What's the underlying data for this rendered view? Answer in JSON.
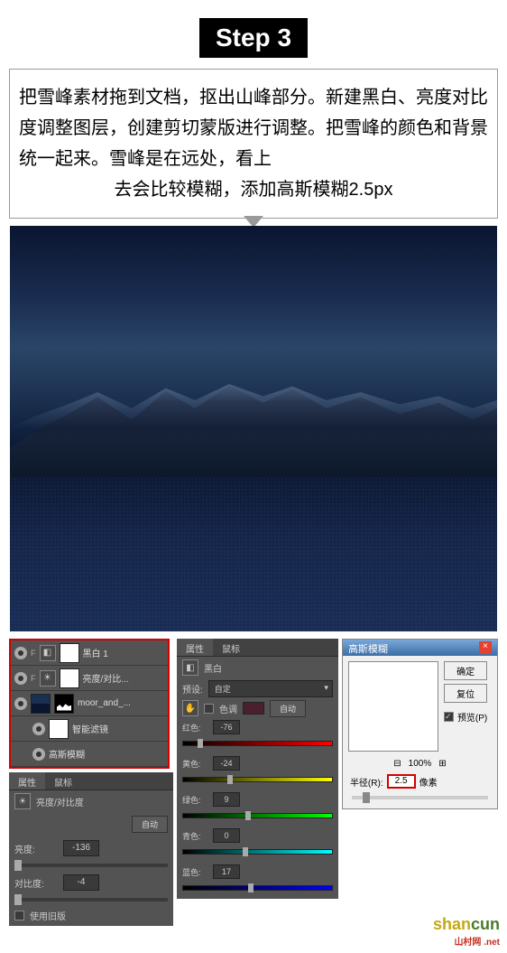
{
  "step": {
    "label": "Step 3",
    "instruction_line1": "把雪峰素材拖到文档，抠出山峰部分。新建黑白、亮度对比度调整图层，创建剪切蒙版进行调整。把雪峰的颜色和背景统一起来。雪峰是在远处，看上",
    "instruction_line2": "去会比较模糊，添加高斯模糊2.5px"
  },
  "layers": {
    "items": [
      {
        "label": "黑白 1",
        "icon": "◧"
      },
      {
        "label": "亮度/对比...",
        "icon": "☀"
      },
      {
        "label": "moor_and_...",
        "icon": ""
      },
      {
        "label": "智能滤镜",
        "sub": true
      },
      {
        "label": "高斯模糊",
        "sub": true
      }
    ]
  },
  "bw_panel": {
    "tab1": "属性",
    "tab2": "鼠标",
    "title": "黑白",
    "preset_label": "预设:",
    "preset_value": "自定",
    "tint_label": "色调",
    "auto": "自动",
    "sliders": [
      {
        "label": "红色:",
        "value": "-76",
        "class": "color-red",
        "pos": "10%"
      },
      {
        "label": "黄色:",
        "value": "-24",
        "class": "color-yellow",
        "pos": "30%"
      },
      {
        "label": "绿色:",
        "value": "9",
        "class": "color-green",
        "pos": "42%"
      },
      {
        "label": "青色:",
        "value": "0",
        "class": "color-cyan",
        "pos": "40%"
      },
      {
        "label": "蓝色:",
        "value": "17",
        "class": "color-blue",
        "pos": "44%"
      }
    ]
  },
  "bc_panel": {
    "tab1": "属性",
    "tab2": "鼠标",
    "title": "亮度/对比度",
    "auto": "自动",
    "brightness_label": "亮度:",
    "brightness_value": "-136",
    "contrast_label": "对比度:",
    "contrast_value": "-4",
    "legacy": "使用旧版"
  },
  "gauss": {
    "title": "高斯模糊",
    "ok": "确定",
    "cancel": "复位",
    "preview": "预览(P)",
    "zoom": "100%",
    "radius_label": "半径(R):",
    "radius_value": "2.5",
    "unit": "像素"
  },
  "watermark": {
    "text1": "shan",
    "text2": "cun",
    "sub": "山村网 .net"
  }
}
